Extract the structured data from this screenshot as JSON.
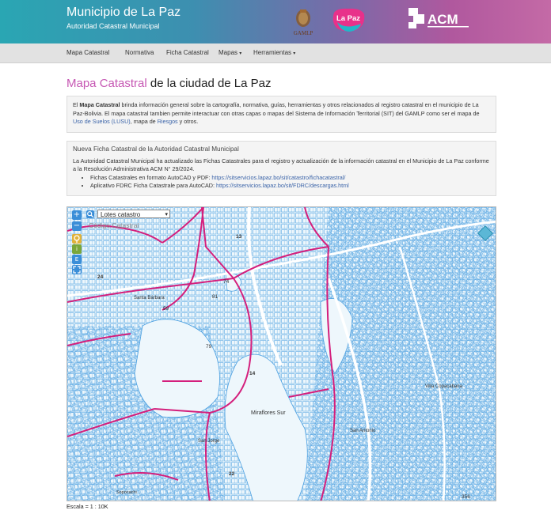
{
  "header": {
    "title": "Municipio de La Paz",
    "subtitle": "Autoridad Catastral Municipal",
    "logos": {
      "gamlp": "GAMLP",
      "lapaz": "La Paz",
      "acm": "ACM"
    }
  },
  "nav": {
    "items": [
      "Mapa Catastral",
      "Normativa",
      "Ficha Catastral",
      "Mapas",
      "Herramientas"
    ],
    "dropdown_caret": "▾"
  },
  "page_title": {
    "accent": "Mapa Catastral",
    "rest": " de la ciudad de La Paz"
  },
  "info": {
    "t1": "El ",
    "bold": "Mapa Catastral",
    "t2": " brinda información general sobre la cartografía, normativa, guías, herramientas y otros relacionados al registro catastral en el municipio de La Paz-Bolivia. El mapa catastral tambien permite interactuar con otras capas o mapas del Sistema de Información Territorial (SIT) del GAMLP como ser el mapa de ",
    "link1": "Uso de Suelos (LUSU)",
    "t3": ", mapa de ",
    "link2": "Riesgos",
    "t4": " y otros."
  },
  "news": {
    "title": "Nueva Ficha Catastral de la Autoridad Catastral Municipal",
    "body": "La Autoridad Catastral Municipal ha actualizado las Fichas Catastrales para el registro y actualización de la información catastral en el Municipio de La Paz conforme a la Resolución Administrativa ACM N° 29/2024.",
    "items": [
      {
        "label": "Fichas Catastrales en formato AutoCAD y PDF: ",
        "url": "https://sitservicios.lapaz.bo/sit/catastro/fichacatastral/"
      },
      {
        "label": "Aplicativo FDRC Ficha Catastrale para AutoCAD: ",
        "url": "https://sitservicios.lapaz.bo/sit/FDRC/descargas.html"
      }
    ]
  },
  "map": {
    "zoom_in": "+",
    "zoom_out": "−",
    "layer_select_value": "Lotes catastro",
    "code_placeholder": "Código Catastral",
    "tool_labels": [
      "i",
      "E"
    ],
    "place_labels": [
      "Miraflores Sur",
      "Santa Bárbara",
      "San Jorge",
      "Sopocachi",
      "San Antonio",
      "Villa Copacabana"
    ],
    "district_numbers": [
      "13",
      "24",
      "14",
      "22",
      "23",
      "356",
      "81",
      "74",
      "79",
      "59"
    ],
    "colors": {
      "parcel_lines": "#4a9fe0",
      "district_lines": "#d41f7c",
      "background": "#eef7fc"
    }
  },
  "scale_label": "Escala = 1 : 10K"
}
